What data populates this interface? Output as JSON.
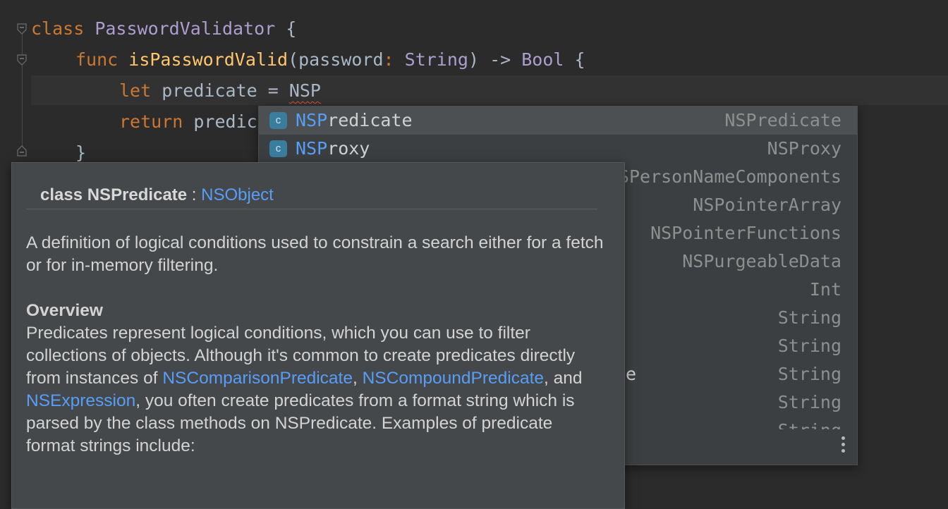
{
  "editor": {
    "lines": {
      "l1_kw": "class",
      "l1_name": "PasswordValidator",
      "l1_rest": " {",
      "l2_kw": "func",
      "l2_fn": "isPasswordValid",
      "l2_p1": "(password",
      "l2_colon": ":",
      "l2_type": "String",
      "l2_p2": ") -> ",
      "l2_ret": "Bool",
      "l2_end": " {",
      "l3_kw": "let",
      "l3_rest": " predicate = ",
      "l3_typed": "NSP",
      "l4_kw": "return",
      "l4_rest": " predic",
      "l5": "}"
    }
  },
  "completion": {
    "items": [
      {
        "icon": "class-icon",
        "badge": "c",
        "match": "NSP",
        "rest": "redicate",
        "type": "NSPredicate"
      },
      {
        "icon": "class-icon",
        "badge": "c",
        "match": "NSP",
        "rest": "roxy",
        "type": "NSProxy"
      },
      {
        "type": "NSPersonNameComponents"
      },
      {
        "type": "NSPointerArray"
      },
      {
        "type": "NSPointerFunctions"
      },
      {
        "type": "NSPurgeableData"
      },
      {
        "type": "Int"
      },
      {
        "type": "String"
      },
      {
        "type": "String"
      },
      {
        "type": "String",
        "visible_fragment": "e"
      },
      {
        "type": "String"
      },
      {
        "type": "String"
      }
    ],
    "more_icon": "vertical-ellipsis-icon"
  },
  "documentation": {
    "header_kw": "class NSPredicate",
    "header_sep": " : ",
    "header_super": "NSObject",
    "summary": "A definition of logical conditions used to constrain a search either for a fetch or for in-memory filtering.",
    "overview_title": "Overview",
    "overview_p1": "Predicates represent logical conditions, which you can use to filter collections of objects. Although it's common to create predicates directly from instances of ",
    "link1": "NSComparisonPredicate",
    "sep1": ", ",
    "link2": "NSCompoundPredicate",
    "sep2": ", and ",
    "link3": "NSExpression",
    "overview_p2": ", you often create predicates from a format string which is parsed by the class methods on NSPredicate. Examples of predicate format strings include:"
  }
}
